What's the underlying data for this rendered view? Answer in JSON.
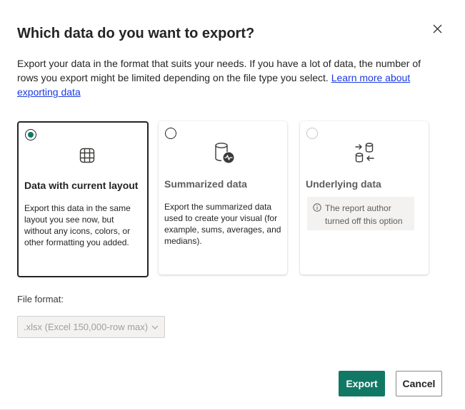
{
  "dialog": {
    "title": "Which data do you want to export?",
    "close_icon": "close-icon",
    "description": "Export your data in the format that suits your needs. If you have a lot of data, the number of rows you export might be limited depending on the file type you select. ",
    "learn_more_link": "Learn more about exporting data"
  },
  "options": [
    {
      "title": "Data with current layout",
      "description": "Export this data in the same layout you see now, but without any icons, colors, or other formatting you added.",
      "icon": "table-grid-icon",
      "selected": true,
      "enabled": true
    },
    {
      "title": "Summarized data",
      "description": "Export the summarized data used to create your visual (for example, sums, averages, and medians).",
      "icon": "database-pulse-icon",
      "selected": false,
      "enabled": true
    },
    {
      "title": "Underlying data",
      "info": "The report author turned off this option",
      "icon": "database-arrows-icon",
      "selected": false,
      "enabled": false
    }
  ],
  "file_format": {
    "label": "File format:",
    "value": ".xlsx (Excel 150,000-row max)",
    "enabled": false
  },
  "buttons": {
    "export": "Export",
    "cancel": "Cancel"
  },
  "colors": {
    "accent": "#117865",
    "link": "#1c3ae0",
    "text": "#252423"
  }
}
